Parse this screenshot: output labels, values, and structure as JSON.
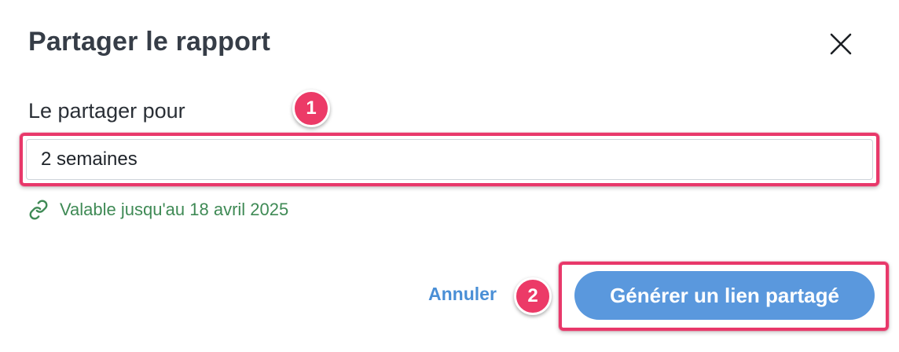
{
  "dialog": {
    "title": "Partager le rapport",
    "close_icon": "close-icon"
  },
  "share": {
    "label": "Le partager pour",
    "duration_value": "2 semaines",
    "validity_icon": "link-icon",
    "validity_text": "Valable jusqu'au 18 avril 2025"
  },
  "footer": {
    "cancel_label": "Annuler",
    "generate_label": "Générer un lien partagé"
  },
  "annotations": {
    "step1": "1",
    "step2": "2"
  },
  "colors": {
    "accent": "#5a98dd",
    "highlight": "#e8386a",
    "success": "#3f8a55"
  }
}
